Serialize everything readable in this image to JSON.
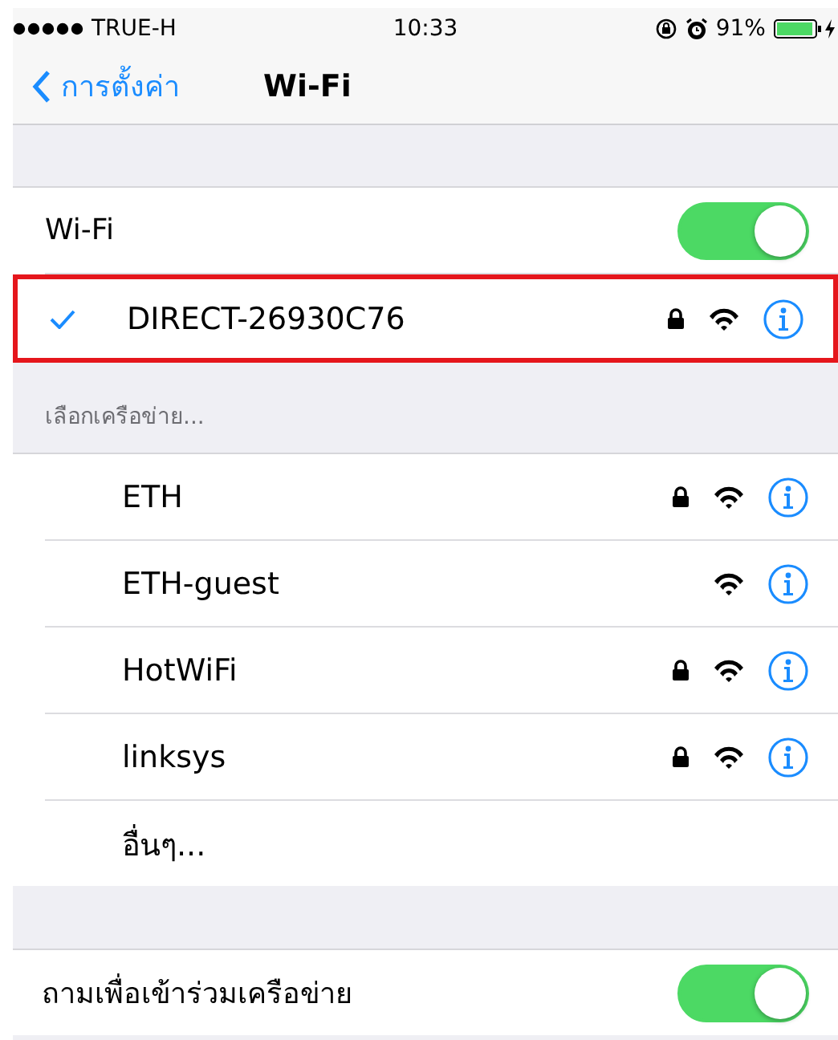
{
  "status_bar": {
    "carrier": "TRUE-H",
    "time": "10:33",
    "battery": "91%"
  },
  "nav": {
    "back": "การตั้งค่า",
    "title": "Wi-Fi"
  },
  "wifi_toggle": {
    "label": "Wi-Fi",
    "on": true
  },
  "current_network": {
    "name": "DIRECT-26930C76",
    "connected": true,
    "locked": true,
    "highlighted": true
  },
  "section_header": "เลือกเครือข่าย...",
  "networks": [
    {
      "kind": "network",
      "name": "ETH",
      "locked": true
    },
    {
      "kind": "network",
      "name": "ETH-guest",
      "locked": false
    },
    {
      "kind": "network",
      "name": "HotWiFi",
      "locked": true
    },
    {
      "kind": "network",
      "name": "linksys",
      "locked": true
    },
    {
      "kind": "other",
      "name": "อื่นๆ..."
    }
  ],
  "ask_toggle": {
    "label": "ถามเพื่อเข้าร่วมเครือข่าย",
    "on": true
  }
}
